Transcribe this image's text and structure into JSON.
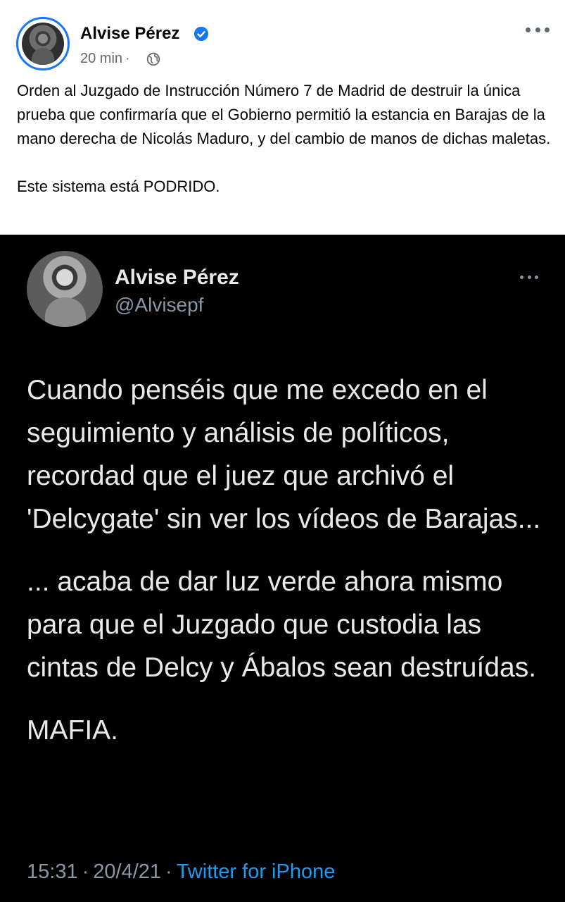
{
  "post": {
    "author": "Alvise Pérez",
    "time": "20 min",
    "separator": "·",
    "text": [
      "Orden al Juzgado de Instrucción Número 7 de Madrid de destruir la única prueba que confirmaría que el Gobierno permitió la estancia en Barajas de la mano derecha de Nicolás Maduro, y del cambio de manos de dichas maletas.",
      "Este sistema está PODRIDO."
    ],
    "icons": {
      "verified": "verified-badge-icon",
      "audience": "globe-icon",
      "more": "more-options-icon"
    },
    "colors": {
      "verified": "#1877f2",
      "meta": "#65676b"
    }
  },
  "tweet": {
    "name": "Alvise Pérez",
    "handle": "@Alvisepf",
    "body": [
      "Cuando penséis que me excedo en el seguimiento y análisis de políticos, recordad que el juez que archivó el 'Delcygate' sin ver los vídeos de Barajas...",
      "... acaba de dar luz verde ahora mismo para que el Juzgado que custodia las cintas de Delcy y Ábalos sean destruídas.",
      "MAFIA."
    ],
    "time": "15:31",
    "date": "20/4/21",
    "sep": "·",
    "source": "Twitter for iPhone",
    "colors": {
      "background": "#000000",
      "text": "#e7e9ea",
      "muted": "#8b98a5",
      "link": "#1d9bf0"
    }
  }
}
